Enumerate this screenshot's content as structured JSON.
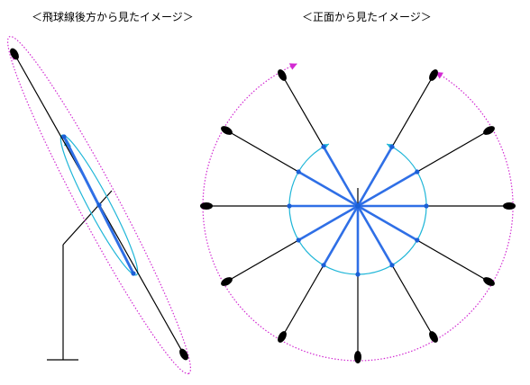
{
  "captions": {
    "left": "＜飛球線後方から見たイメージ＞",
    "right": "＜正面から見たイメージ＞"
  },
  "colors": {
    "stroke": "#000000",
    "club_head": "#000000",
    "inner_swing": "#2f6fe6",
    "inner_arc": "#1fb6d8",
    "outer_arc": "#d22ad2",
    "joint": "#1a5fd6"
  },
  "front_view": {
    "clock_positions_deg": [
      -90,
      -60,
      -30,
      0,
      30,
      60,
      90,
      120,
      150,
      180,
      210,
      240
    ],
    "outer_arc_start_deg": 62,
    "outer_arc_end_deg": 270,
    "inner_arc_start_deg": 55,
    "inner_arc_end_deg": 245
  }
}
